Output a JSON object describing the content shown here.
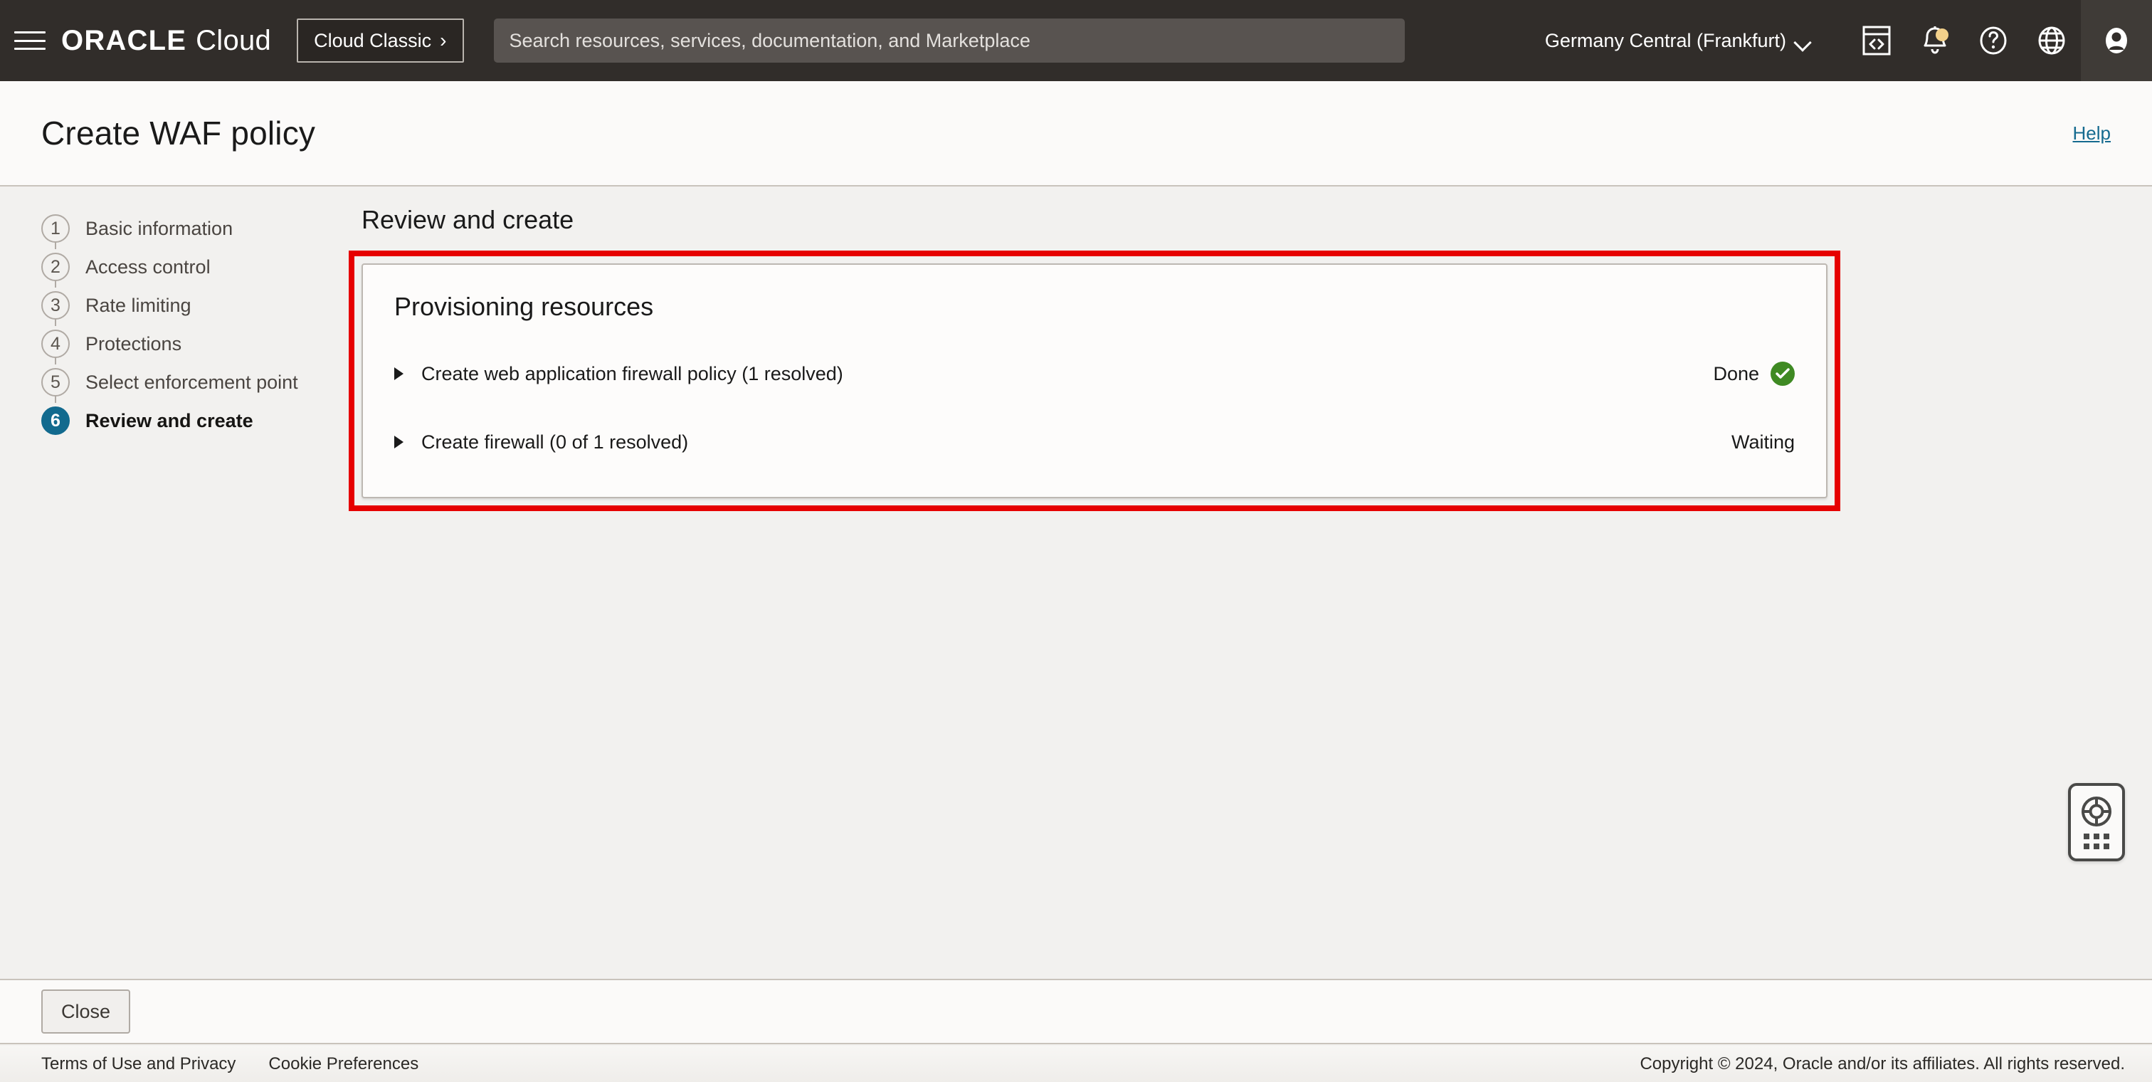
{
  "topbar": {
    "menu_icon": "hamburger-menu-icon",
    "brand_primary": "ORACLE",
    "brand_secondary": "Cloud",
    "cloud_classic_label": "Cloud Classic",
    "cloud_classic_chevron": "›",
    "search": {
      "placeholder": "Search resources, services, documentation, and Marketplace",
      "value": ""
    },
    "region": "Germany Central (Frankfurt)",
    "icons": [
      {
        "name": "cloud-shell-icon",
        "label": "Cloud Shell"
      },
      {
        "name": "notifications-bell-icon",
        "label": "Notifications",
        "has_badge": true
      },
      {
        "name": "help-question-icon",
        "label": "Help"
      },
      {
        "name": "language-globe-icon",
        "label": "Language"
      },
      {
        "name": "user-avatar-icon",
        "label": "Profile"
      }
    ]
  },
  "titlebar": {
    "title": "Create WAF policy",
    "help_label": "Help"
  },
  "wizard": {
    "steps": [
      {
        "num": "1",
        "label": "Basic information",
        "active": false
      },
      {
        "num": "2",
        "label": "Access control",
        "active": false
      },
      {
        "num": "3",
        "label": "Rate limiting",
        "active": false
      },
      {
        "num": "4",
        "label": "Protections",
        "active": false
      },
      {
        "num": "5",
        "label": "Select enforcement point",
        "active": false
      },
      {
        "num": "6",
        "label": "Review and create",
        "active": true
      }
    ]
  },
  "main": {
    "section_heading": "Review and create",
    "card": {
      "title": "Provisioning resources",
      "rows": [
        {
          "label": "Create web application firewall policy (1 resolved)",
          "status": "Done",
          "status_icon": "green-check-circle-icon",
          "expanded": false
        },
        {
          "label": "Create firewall (0 of 1 resolved)",
          "status": "Waiting",
          "status_icon": "",
          "expanded": false
        }
      ]
    },
    "highlight_color": "#e60000"
  },
  "support_widget": {
    "icon": "life-preserver-icon",
    "drag_handle": "drag-dots-icon"
  },
  "action_footer": {
    "close_label": "Close"
  },
  "page_footer": {
    "links": [
      {
        "label": "Terms of Use and Privacy"
      },
      {
        "label": "Cookie Preferences"
      }
    ],
    "copyright": "Copyright © 2024, Oracle and/or its affiliates. All rights reserved."
  },
  "colors": {
    "topbar_bg": "#312d2a",
    "accent_blue": "#126a8e",
    "link_blue": "#156a8f",
    "status_green": "#3f8a23",
    "highlight_red": "#e60000",
    "notification_badge": "#f2d08a"
  }
}
